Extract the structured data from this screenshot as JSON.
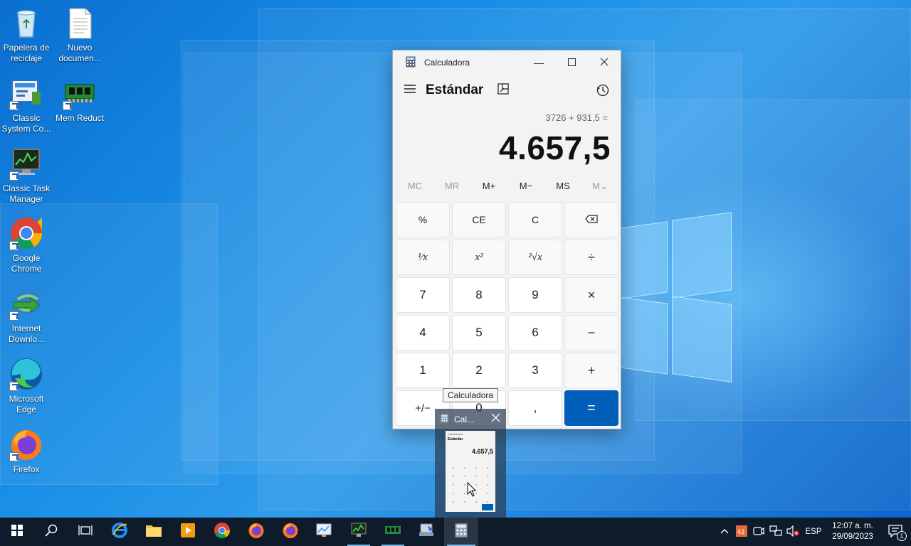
{
  "desktop": {
    "icons": [
      {
        "label": "Papelera de reciclaje",
        "icon": "recycle-bin-icon"
      },
      {
        "label": "Nuevo documen...",
        "icon": "text-document-icon"
      },
      {
        "label": "Classic System Co...",
        "icon": "control-panel-icon"
      },
      {
        "label": "Mem Reduct",
        "icon": "memory-chip-icon"
      },
      {
        "label": "Classic Task Manager",
        "icon": "task-manager-icon"
      },
      {
        "label": "Google Chrome",
        "icon": "chrome-icon"
      },
      {
        "label": "Internet Downlo...",
        "icon": "download-manager-icon"
      },
      {
        "label": "Microsoft Edge",
        "icon": "edge-icon"
      },
      {
        "label": "Firefox",
        "icon": "firefox-icon"
      }
    ]
  },
  "calculator": {
    "window_title": "Calculadora",
    "mode": "Estándar",
    "expression": "3726 + 931,5 =",
    "result": "4.657,5",
    "memory": [
      "MC",
      "MR",
      "M+",
      "M−",
      "MS",
      "M⌄"
    ],
    "keys": {
      "percent": "%",
      "ce": "CE",
      "clear": "C",
      "backspace": "⌫",
      "reciprocal": "¹⁄x",
      "square": "x²",
      "sqrt": "²√x",
      "divide": "÷",
      "seven": "7",
      "eight": "8",
      "nine": "9",
      "multiply": "×",
      "four": "4",
      "five": "5",
      "six": "6",
      "minus": "−",
      "one": "1",
      "two": "2",
      "three": "3",
      "plus": "+",
      "negate": "+/−",
      "zero": "0",
      "decimal": ",",
      "equals": "="
    }
  },
  "tooltip": "Calculadora",
  "thumbnail": {
    "label": "Cal...",
    "preview_title": "Calculadora",
    "preview_mode": "Estándar",
    "preview_value": "4.657,5"
  },
  "taskbar": {
    "apps": [
      "start-icon",
      "search-icon",
      "task-view-icon",
      "internet-explorer-icon",
      "file-explorer-icon",
      "media-player-icon",
      "chrome-icon",
      "firefox-icon",
      "firefox-icon",
      "control-panel-icon",
      "task-manager-icon",
      "mem-reduct-icon",
      "network-app-icon",
      "calculator-icon"
    ],
    "tray": {
      "language": "ESP",
      "time": "12:07 a. m.",
      "date": "29/09/2023",
      "notification_count": "1"
    }
  },
  "colors": {
    "accent": "#005fb8",
    "taskbar": "#0d1b2a",
    "desktop": "#1a8fe6"
  }
}
